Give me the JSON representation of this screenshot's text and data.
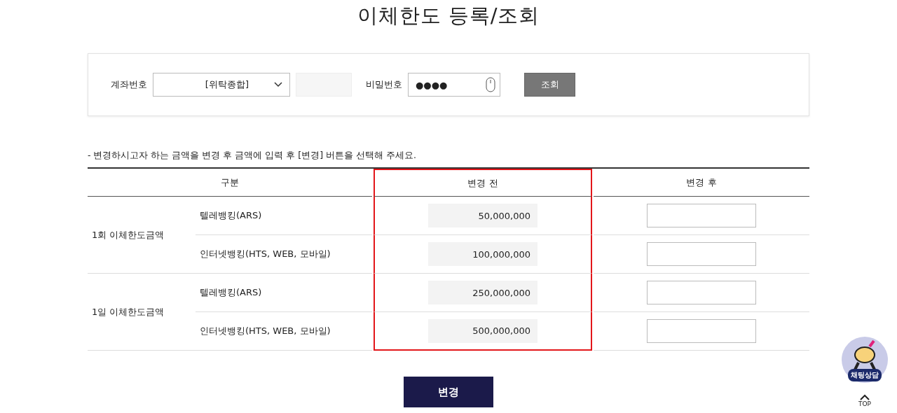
{
  "title": "이체한도 등록/조회",
  "search": {
    "account_label": "계좌번호",
    "account_type": "[위탁종합]",
    "password_label": "비밀번호",
    "password_value": "●●●●",
    "button": "조회"
  },
  "note": "- 변경하시고자 하는 금액을 변경 후 금액에 입력 후 [변경] 버튼을 선택해 주세요.",
  "table": {
    "columns": [
      {
        "label": "구분",
        "highlighted": false
      },
      {
        "label": "변경 전",
        "highlighted": true
      },
      {
        "label": "변경 후",
        "highlighted": false
      }
    ],
    "groups": [
      {
        "label": "1회 이체한도금액",
        "rows": [
          {
            "channel": "텔레뱅킹(ARS)",
            "before": "50,000,000"
          },
          {
            "channel": "인터넷뱅킹(HTS, WEB, 모바일)",
            "before": "100,000,000"
          }
        ]
      },
      {
        "label": "1일 이체한도금액",
        "rows": [
          {
            "channel": "텔레뱅킹(ARS)",
            "before": "250,000,000"
          },
          {
            "channel": "인터넷뱅킹(HTS, WEB, 모바일)",
            "before": "500,000,000"
          }
        ]
      }
    ]
  },
  "submit_button": "변경",
  "chat": {
    "label": "채팅상담",
    "top": "TOP"
  }
}
